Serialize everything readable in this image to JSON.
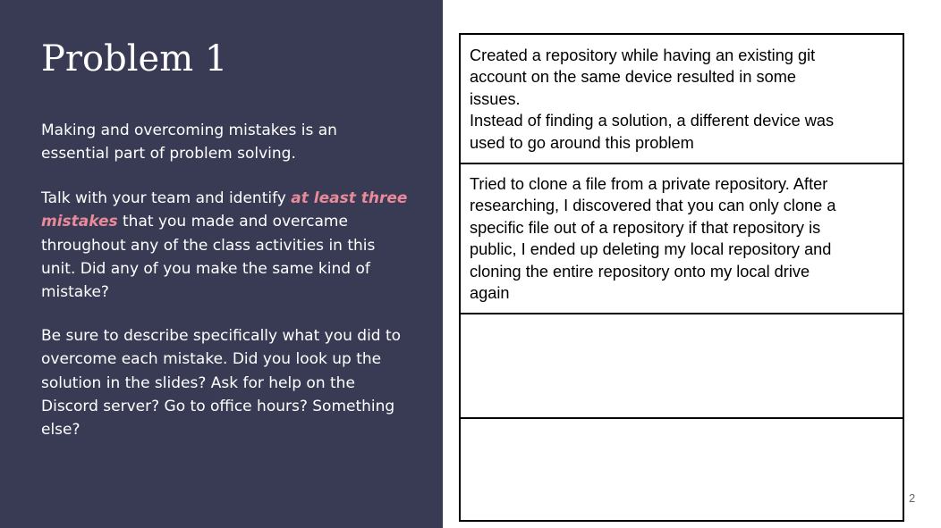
{
  "slide": {
    "title": "Problem 1",
    "paragraph1": "Making and overcoming mistakes is an essential part of problem solving.",
    "paragraph2_before": "Talk with your team and identify ",
    "paragraph2_highlight": "at least three mistakes",
    "paragraph2_after": " that you made and overcame throughout any of the class activities in this unit. Did any of you make the same kind of mistake?",
    "paragraph3": "Be sure to describe specifically what you did to overcome each mistake. Did you look up the solution in the slides? Ask for help on the Discord server? Go to office hours? Something else?",
    "slide_number": "2"
  },
  "table": {
    "rows": [
      {
        "text": "Created a repository while having an existing git account on the same device resulted in some issues.\nInstead of finding a solution, a different device was used to go around this problem"
      },
      {
        "text": "Tried to clone a file from a  private repository. After researching, I discovered that you can only clone a specific file out of a repository if that repository is public, I ended up deleting my local repository and cloning the entire repository onto my local drive again"
      },
      {
        "text": ""
      },
      {
        "text": ""
      }
    ]
  },
  "colors": {
    "panel_background": "#383b53",
    "highlight": "#e88a9a",
    "text_light": "#ffffff"
  }
}
